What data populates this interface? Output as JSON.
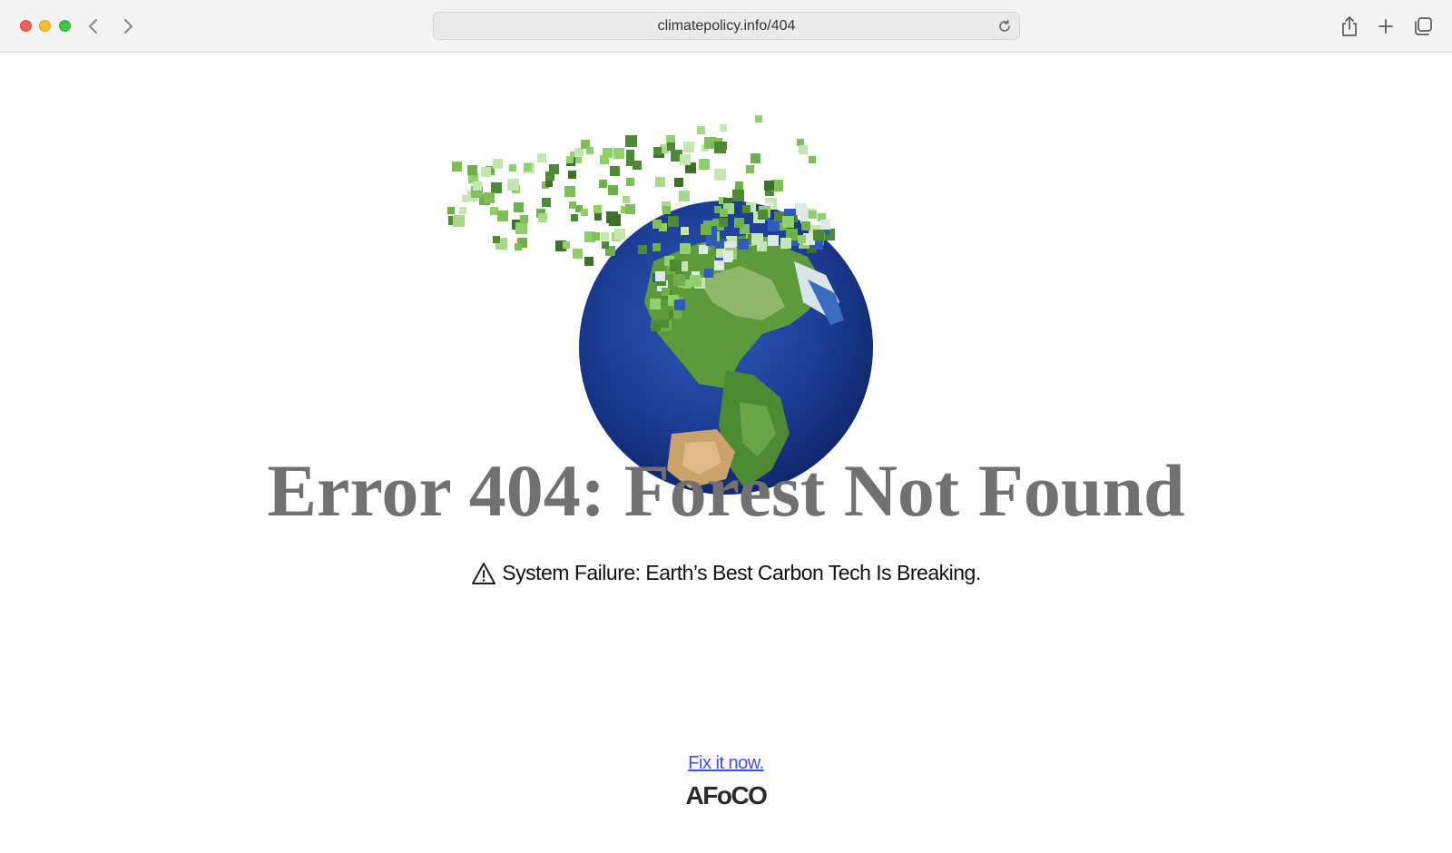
{
  "browser": {
    "url": "climatepolicy.info/404",
    "icons": {
      "back": "chevron-left-icon",
      "forward": "chevron-right-icon",
      "reload": "reload-icon",
      "share": "share-icon",
      "new_tab": "plus-icon",
      "tab_overview": "tabs-icon"
    }
  },
  "page": {
    "headline": "Error 404: Forest Not Found",
    "subline": "System Failure:  Earth’s Best Carbon Tech Is Breaking.",
    "warning_icon": "warning-icon",
    "cta_link": "Fix it now.",
    "brand": "AFoCO",
    "colors": {
      "headline": "#717171",
      "link": "#3f4ff0",
      "ocean": "#1e3f8f",
      "forest": "#6fb04a",
      "pixels_light": "#a8d98a"
    }
  }
}
